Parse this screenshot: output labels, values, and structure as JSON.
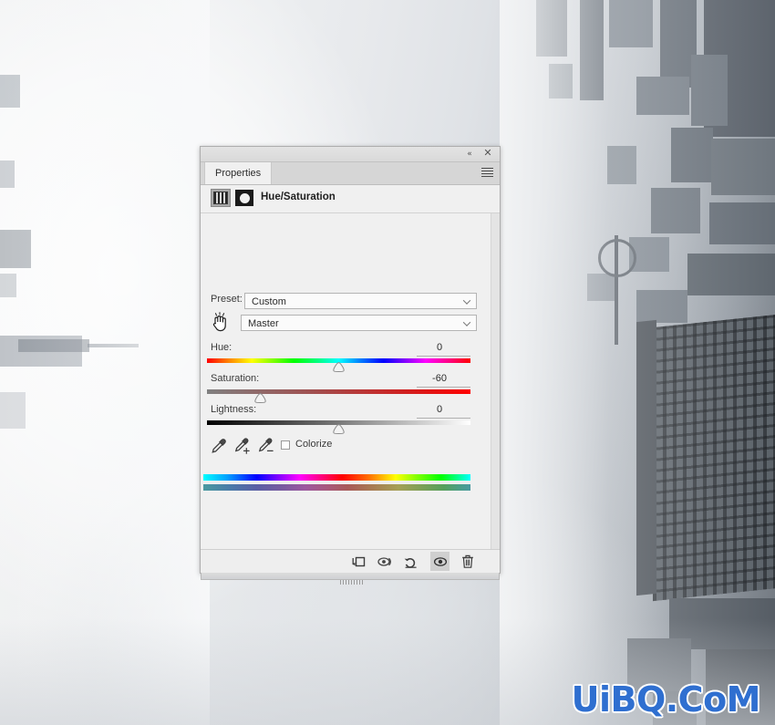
{
  "app": {
    "panel_title": "Properties",
    "adjustment_name": "Hue/Saturation"
  },
  "titlebar": {
    "collapse_icon": "collapse-double-arrow-icon",
    "collapse_glyph": "«",
    "close_icon": "close-icon",
    "close_glyph": "✕"
  },
  "tabs": [
    {
      "label": "Properties",
      "active": true
    }
  ],
  "panel_menu": {
    "icon": "hamburger-menu-icon"
  },
  "adjustment_header": {
    "layer_thumbnail_icon": "adjustment-layer-thumbnail-icon",
    "mask_thumbnail_icon": "layer-mask-thumbnail-icon",
    "title": "Hue/Saturation"
  },
  "preset": {
    "label": "Preset:",
    "value": "Custom",
    "placeholder": "Custom",
    "arrow_icon": "chevron-down-icon"
  },
  "channel": {
    "value": "Master",
    "placeholder": "Master",
    "arrow_icon": "chevron-down-icon",
    "cursor_icon": "hand-cursor-icon"
  },
  "sliders": [
    {
      "id": "hue",
      "label": "Hue:",
      "value": "0",
      "percent": 50,
      "min": -180,
      "max": 180
    },
    {
      "id": "saturation",
      "label": "Saturation:",
      "value": "-60",
      "percent": 20,
      "min": -100,
      "max": 100
    },
    {
      "id": "lightness",
      "label": "Lightness:",
      "value": "0",
      "percent": 50,
      "min": -100,
      "max": 100
    }
  ],
  "eyedroppers": [
    {
      "icon": "eyedropper-icon",
      "name": "sample-color"
    },
    {
      "icon": "eyedropper-plus-icon",
      "name": "add-to-sample"
    },
    {
      "icon": "eyedropper-minus-icon",
      "name": "subtract-from-sample"
    }
  ],
  "colorize": {
    "label": "Colorize",
    "checked": false
  },
  "color_range": {
    "top_bar_name": "hue-range-bar-full",
    "bottom_bar_name": "hue-range-bar-result"
  },
  "footer_buttons": [
    {
      "name": "clip-to-layer-button",
      "icon": "clip-to-layer-icon",
      "active": false
    },
    {
      "name": "view-previous-state-button",
      "icon": "eye-previous-state-icon",
      "active": false
    },
    {
      "name": "reset-button",
      "icon": "reset-arrow-icon",
      "active": false
    },
    {
      "name": "toggle-visibility-button",
      "icon": "eye-icon",
      "active": true
    },
    {
      "name": "delete-layer-button",
      "icon": "trash-icon",
      "active": false
    }
  ],
  "watermark": {
    "text": "UiBQ.CoM",
    "color": "#2f6fd0"
  },
  "background": {
    "description": "foggy-city-skyline-photo"
  },
  "colors": {
    "panel_bg": "#f0f0f0",
    "panel_border": "#adadad",
    "tab_bg": "#d6d6d6",
    "footer_bg": "#eeeeee",
    "accent_blue": "#2f6fd0"
  }
}
